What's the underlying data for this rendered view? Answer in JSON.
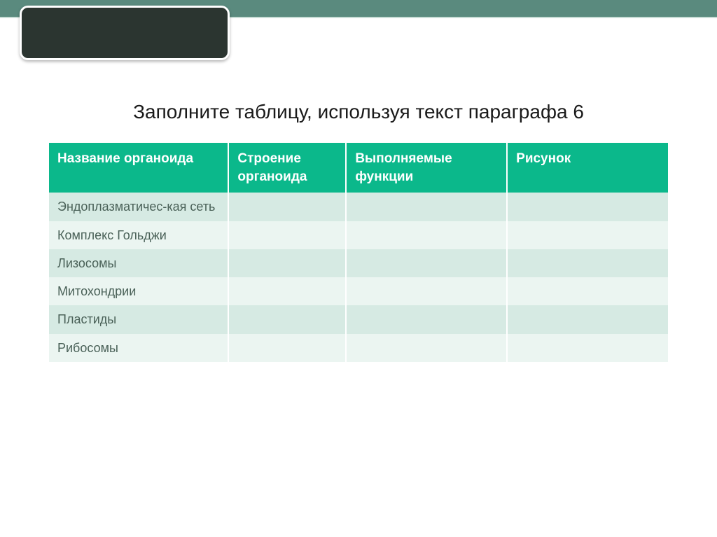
{
  "title": "Заполните таблицу, используя текст параграфа 6",
  "table": {
    "headers": [
      "Название органоида",
      "Строение органоида",
      "Выполняемые функции",
      "Рисунок"
    ],
    "rows": [
      {
        "name": "Эндоплазматичес-кая сеть",
        "structure": "",
        "functions": "",
        "picture": ""
      },
      {
        "name": "Комплекс Гольджи",
        "structure": "",
        "functions": "",
        "picture": ""
      },
      {
        "name": "Лизосомы",
        "structure": "",
        "functions": "",
        "picture": ""
      },
      {
        "name": "Митохондрии",
        "structure": "",
        "functions": "",
        "picture": ""
      },
      {
        "name": "Пластиды",
        "structure": "",
        "functions": "",
        "picture": ""
      },
      {
        "name": "Рибосомы",
        "structure": "",
        "functions": "",
        "picture": ""
      }
    ]
  }
}
